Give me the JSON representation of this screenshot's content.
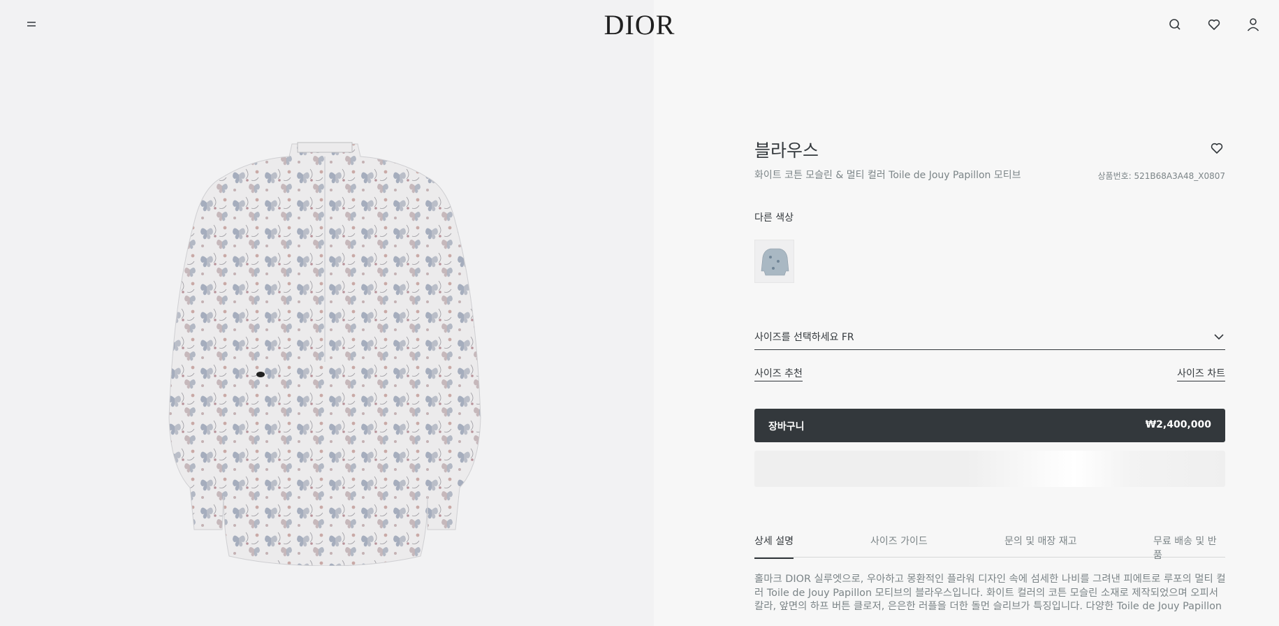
{
  "header": {
    "logo": "DIOR"
  },
  "product": {
    "title": "블라우스",
    "subtitle": "화이트 코튼 모슬린 & 멀티 컬러 Toile de Jouy Papillon 모티브",
    "sku": "상품번호: 521B68A3A48_X0807",
    "other_colors_label": "다른 색상",
    "size_select_label": "사이즈를 선택하세요 FR",
    "size_recommend": "사이즈 추천",
    "size_chart": "사이즈 차트",
    "cart_label": "장바구니",
    "price": "₩2,400,000"
  },
  "tabs": [
    {
      "label": "상세 설명",
      "active": true
    },
    {
      "label": "사이즈 가이드",
      "active": false
    },
    {
      "label": "문의 및 매장 재고",
      "active": false
    },
    {
      "label": "무료 배송 및 반품",
      "active": false
    }
  ],
  "description": "홀마크 DIOR 실루엣으로, 우아하고 몽환적인 플라워 디자인 속에 섬세한 나비를 그려낸 피에트로 루포의 멀티 컬러 Toile de Jouy Papillon 모티브의 블라우스입니다. 화이트 컬러의 코튼 모슬린 소재로 제작되었으며 오피서 칼라, 앞면의 하프 버튼 클로저, 은은한 러플을 더한 돌먼 슬리브가 특징입니다. 다양한 Toile de Jouy Papillon 아이템과 …",
  "colors": {
    "primary": "#33383c",
    "muted": "#7b8487",
    "left_bg": "#f2f2f3",
    "right_bg": "#f7f7f7"
  },
  "icons": {
    "menu": "menu-icon",
    "search": "search-icon",
    "wishlist": "heart-icon",
    "account": "user-icon",
    "dropdown": "chevron-down-icon"
  }
}
